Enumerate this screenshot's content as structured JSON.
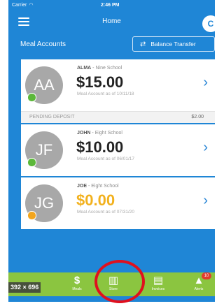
{
  "status_bar": {
    "carrier": "Carrier",
    "time": "2:46 PM"
  },
  "nav": {
    "title": "Home",
    "profile_glyph": "C"
  },
  "meal_accounts": {
    "title": "Meal Accounts",
    "balance_transfer_label": "Balance Transfer"
  },
  "accounts": [
    {
      "initials": "AA",
      "name": "ALMA",
      "school": "Nine School",
      "amount": "$15.00",
      "as_of": "Meal Account as of 10/11/18",
      "status_color": "#5cb83a"
    },
    {
      "initials": "JF",
      "name": "JOHN",
      "school": "Eight School",
      "amount": "$10.00",
      "as_of": "Meal Account as of 06/01/17",
      "status_color": "#5cb83a"
    },
    {
      "initials": "JG",
      "name": "JOE",
      "school": "Eight School",
      "amount": "$0.00",
      "as_of": "Meal Account as of 07/31/20",
      "status_color": "#f2a51d"
    }
  ],
  "pending_deposit": {
    "label": "PENDING DEPOSIT",
    "amount": "$2.00"
  },
  "tabs": [
    {
      "label": "Meals",
      "icon": "dollar-icon",
      "glyph": "$"
    },
    {
      "label": "Store",
      "icon": "store-icon",
      "glyph": "▥"
    },
    {
      "label": "Invoices",
      "icon": "invoice-icon",
      "glyph": "▤"
    },
    {
      "label": "Alerts",
      "icon": "bell-icon",
      "glyph": "▲",
      "badge": "10"
    }
  ],
  "overlay": {
    "dimension_label": "392 × 696"
  },
  "colors": {
    "primary_blue": "#1f86d6",
    "tab_green": "#8bc540",
    "highlight_red": "#e0101e"
  }
}
